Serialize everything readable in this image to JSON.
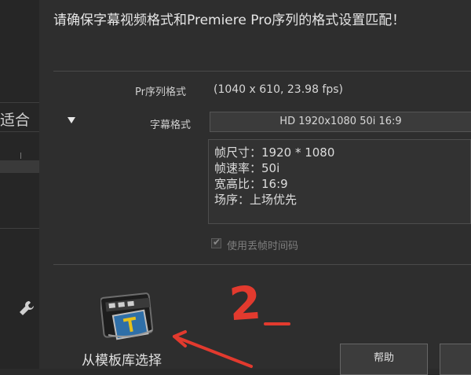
{
  "header": {
    "message": "请确保字幕视频格式和Premiere Pro序列的格式设置匹配！"
  },
  "left_panel": {
    "partial_text": "适合"
  },
  "sequence": {
    "label": "Pr序列格式",
    "value": "(1040 x 610, 23.98 fps)"
  },
  "caption_format": {
    "label": "字幕格式",
    "selected": "HD 1920x1080 50i 16:9"
  },
  "details": {
    "frame_size": "帧尺寸：1920 * 1080",
    "frame_rate": "帧速率：50i",
    "aspect_ratio": "宽高比：16:9",
    "field_order": "场序：上场优先"
  },
  "drop_frame": {
    "label": "使用丢帧时间码",
    "checked": true,
    "enabled": false
  },
  "template": {
    "label": "从模板库选择"
  },
  "buttons": {
    "help": "帮助"
  },
  "annotation": {
    "mark": "2",
    "color": "#e23a2e"
  },
  "colors": {
    "background": "#2e2e2e",
    "panel": "#262626",
    "annotation": "#e23a2e"
  }
}
